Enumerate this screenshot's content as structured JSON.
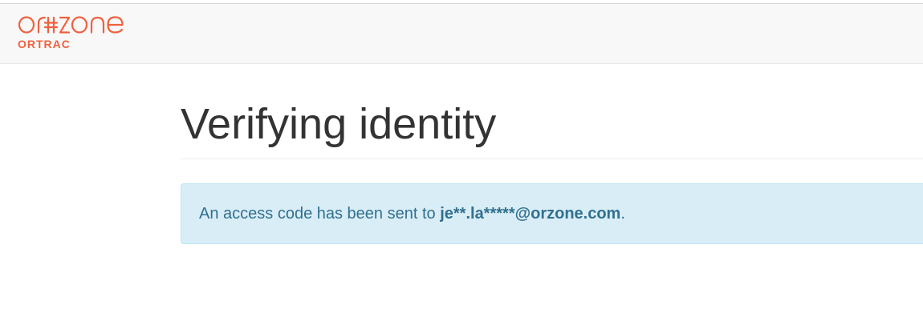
{
  "brand": {
    "logo_text": "ORZONE",
    "sub_label": "ORTRAC",
    "color": "#f0603f"
  },
  "page": {
    "title": "Verifying identity"
  },
  "alert": {
    "prefix": "An access code has been sent to ",
    "email": "je**.la*****@orzone.com",
    "suffix": ".",
    "background": "#d9edf7",
    "text_color": "#31708f"
  }
}
